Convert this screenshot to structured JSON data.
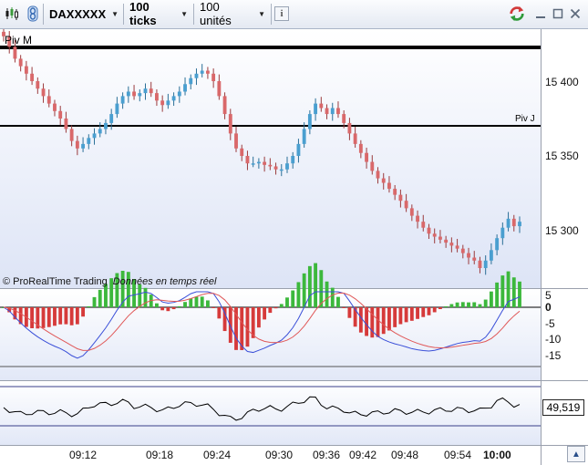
{
  "toolbar": {
    "instrument": "DAXXXXX",
    "ticks": "100 ticks",
    "units": "100 unités",
    "info_glyph": "i",
    "icons": [
      "candlestick-icon",
      "link-icon",
      "sync-icon",
      "minimize-icon",
      "restore-icon",
      "close-icon"
    ]
  },
  "chart": {
    "piv_m_label": "Piv M",
    "piv_j_label": "Piv J",
    "credit": "© ProRealTime Trading",
    "credit_realtime": "Données en temps réel",
    "price_axis": [
      "15 400",
      "15 350",
      "15 300"
    ],
    "osc_axis": [
      "5",
      "0",
      "-5",
      "-10",
      "-15"
    ],
    "third_value": "49,519",
    "time_axis": [
      "09:12",
      "09:18",
      "09:24",
      "09:30",
      "09:36",
      "09:42",
      "09:48",
      "09:54",
      "10:00"
    ],
    "colors": {
      "up": "#4a9fd0",
      "down": "#d9686a",
      "hist_up": "#3cb83c",
      "hist_down": "#d63a3a",
      "macd": "#3a4fd8",
      "signal": "#e05858"
    }
  },
  "chart_data": {
    "type": "candlestick",
    "price_range": [
      15266,
      15435
    ],
    "pivots": {
      "Piv M": 15425,
      "Piv J": 15370
    },
    "closes": [
      15430,
      15423,
      15415,
      15410,
      15405,
      15400,
      15395,
      15390,
      15385,
      15380,
      15375,
      15368,
      15360,
      15355,
      15358,
      15362,
      15365,
      15368,
      15372,
      15378,
      15385,
      15390,
      15393,
      15390,
      15392,
      15395,
      15392,
      15387,
      15384,
      15387,
      15390,
      15393,
      15398,
      15402,
      15405,
      15407,
      15405,
      15400,
      15390,
      15378,
      15365,
      15355,
      15350,
      15345,
      15345,
      15346,
      15344,
      15343,
      15341,
      15341,
      15345,
      15350,
      15358,
      15368,
      15378,
      15385,
      15382,
      15378,
      15382,
      15378,
      15372,
      15365,
      15358,
      15352,
      15346,
      15340,
      15335,
      15332,
      15328,
      15324,
      15320,
      15315,
      15310,
      15306,
      15302,
      15298,
      15296,
      15294,
      15292,
      15290,
      15288,
      15285,
      15282,
      15280,
      15275,
      15280,
      15287,
      15295,
      15302,
      15308,
      15303,
      15306
    ]
  }
}
